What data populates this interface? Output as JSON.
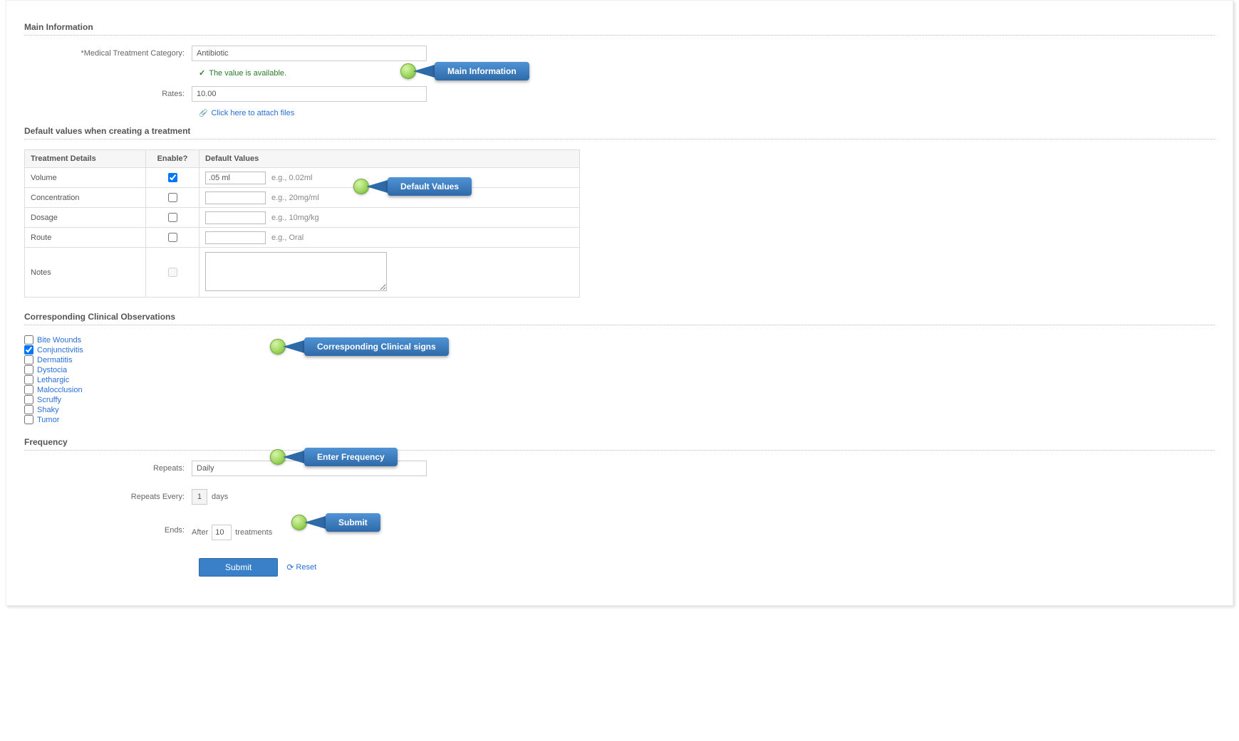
{
  "main_info": {
    "title": "Main Information",
    "category_label": "*Medical Treatment Category:",
    "category_value": "Antibiotic",
    "available_msg": "The value is available.",
    "rates_label": "Rates:",
    "rates_value": "10.00",
    "attach_link": "Click here to attach files"
  },
  "defaults": {
    "title": "Default values when creating a treatment",
    "headers": {
      "details": "Treatment Details",
      "enable": "Enable?",
      "values": "Default Values"
    },
    "rows": [
      {
        "label": "Volume",
        "enabled": true,
        "value": ".05 ml",
        "hint": "e.g., 0.02ml"
      },
      {
        "label": "Concentration",
        "enabled": false,
        "value": "",
        "hint": "e.g., 20mg/ml"
      },
      {
        "label": "Dosage",
        "enabled": false,
        "value": "",
        "hint": "e.g., 10mg/kg"
      },
      {
        "label": "Route",
        "enabled": false,
        "value": "",
        "hint": "e.g., Oral"
      }
    ],
    "notes_label": "Notes",
    "notes_value": ""
  },
  "observations": {
    "title": "Corresponding Clinical Observations",
    "items": [
      {
        "label": "Bite Wounds",
        "checked": false
      },
      {
        "label": "Conjunctivitis",
        "checked": true
      },
      {
        "label": "Dermatitis",
        "checked": false
      },
      {
        "label": "Dystocia",
        "checked": false
      },
      {
        "label": "Lethargic",
        "checked": false
      },
      {
        "label": "Malocclusion",
        "checked": false
      },
      {
        "label": "Scruffy",
        "checked": false
      },
      {
        "label": "Shaky",
        "checked": false
      },
      {
        "label": "Tumor",
        "checked": false
      }
    ]
  },
  "frequency": {
    "title": "Frequency",
    "repeats_label": "Repeats:",
    "repeats_value": "Daily",
    "every_label": "Repeats Every:",
    "every_value": "1",
    "every_unit": "days",
    "ends_label": "Ends:",
    "ends_prefix": "After",
    "ends_value": "10",
    "ends_suffix": "treatments"
  },
  "actions": {
    "submit": "Submit",
    "reset": "Reset"
  },
  "callouts": {
    "main": "Main Information",
    "defaults": "Default Values",
    "clinical": "Corresponding Clinical signs",
    "frequency": "Enter Frequency",
    "submit": "Submit"
  }
}
